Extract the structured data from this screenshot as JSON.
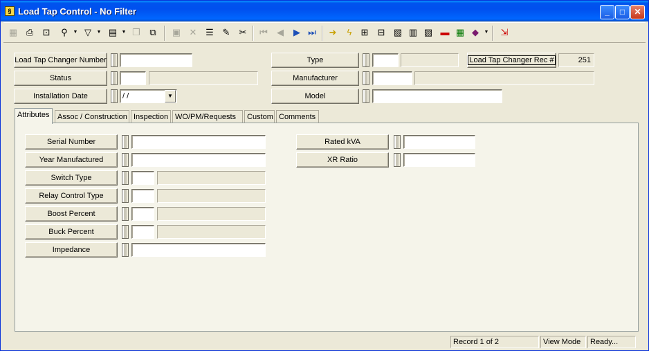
{
  "window": {
    "title": "Load Tap Control - No Filter",
    "app_icon": "app-icon"
  },
  "header": {
    "ltc_number_label": "Load Tap Changer Number",
    "ltc_number_value": "",
    "status_label": "Status",
    "status_code": "",
    "status_desc": "",
    "install_date_label": "Installation Date",
    "install_date_value": " /  /",
    "type_label": "Type",
    "type_code": "",
    "type_desc": "",
    "manufacturer_label": "Manufacturer",
    "manufacturer_code": "",
    "manufacturer_desc": "",
    "model_label": "Model",
    "model_value": "",
    "rec_label": "Load Tap Changer Rec #",
    "rec_value": "251"
  },
  "tabs": [
    "Attributes",
    "Assoc / Construction",
    "Inspection",
    "WO/PM/Requests",
    "Custom",
    "Comments"
  ],
  "attributes": {
    "serial_number_label": "Serial Number",
    "serial_number_value": "",
    "year_manufactured_label": "Year Manufactured",
    "year_manufactured_value": "",
    "switch_type_label": "Switch Type",
    "relay_control_type_label": "Relay Control Type",
    "boost_percent_label": "Boost Percent",
    "buck_percent_label": "Buck Percent",
    "impedance_label": "Impedance",
    "impedance_value": "",
    "rated_kva_label": "Rated kVA",
    "rated_kva_value": "",
    "xr_ratio_label": "XR Ratio",
    "xr_ratio_value": ""
  },
  "status_bar": {
    "record": "Record 1 of 2",
    "mode": "View Mode",
    "state": "Ready..."
  }
}
